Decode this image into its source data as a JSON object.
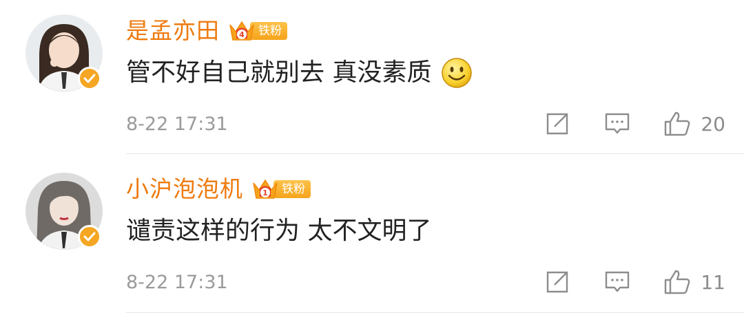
{
  "comments": [
    {
      "username": "是孟亦田",
      "fan_badge": "铁粉",
      "badge_level": "4",
      "content": "管不好自己就别去  真没素质",
      "emoji": "smile-emoji",
      "timestamp": "8-22 17:31",
      "likes": "20"
    },
    {
      "username": "小沪泡泡机",
      "fan_badge": "铁粉",
      "badge_level": "1",
      "content": "谴责这样的行为 太不文明了",
      "timestamp": "8-22 17:31",
      "likes": "11"
    }
  ],
  "icons": {
    "share": "share-icon",
    "reply": "comment-icon",
    "like": "thumbs-up-icon",
    "verified": "verified-badge-icon",
    "crown": "crown-icon"
  },
  "colors": {
    "username": "#ee7a0e",
    "badge": "#f6a41b",
    "verified": "#f5a623",
    "text": "#222222",
    "meta": "#9a9a9a"
  }
}
